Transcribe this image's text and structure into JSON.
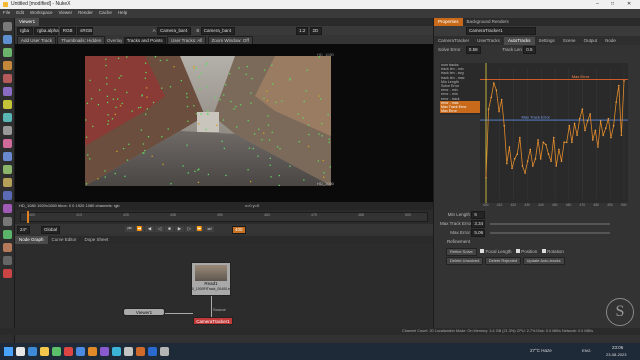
{
  "titlebar": {
    "title": "Untitled [modified] - NukeX",
    "min": "–",
    "max": "□",
    "close": "✕"
  },
  "menubar": {
    "items": [
      "File",
      "Edit",
      "Workspace",
      "Viewer",
      "Render",
      "Cache",
      "Help"
    ]
  },
  "viewer_tab": {
    "label": "Viewer1"
  },
  "viewer_toolbar": {
    "channels": "rgba",
    "alpha": "rgba.alpha",
    "colorspace": "RGB",
    "proxy": "sRGB",
    "ab_a": "A",
    "cam_a": "Camera_bar4",
    "ab_b": "B",
    "cam_b": "Camera_bar4",
    "zoom": "1:2",
    "frame_ctrl": "2D",
    "add_user_track": "Add User Track",
    "thumbnails": "Thumbnails: Hidden",
    "overlay_label": "Overlay",
    "overlay_value": "Tracks and Points",
    "user_tracks": "User Tracks: All",
    "zoom_window": "Zoom Window: Off"
  },
  "viewer": {
    "format_label": "HD_1080",
    "corner_label": "HD_1080",
    "status": "HD_1080 1920x1080  bbox: 0 0 1920 1080 channels: rgb",
    "coords": "x=0 y=0"
  },
  "timeline": {
    "fps": "24*",
    "scope": "Global",
    "frame": "400",
    "ticks": [
      "400",
      "413",
      "425",
      "438",
      "450",
      "463",
      "475",
      "488",
      "500"
    ],
    "current": "400"
  },
  "bottom_tabs": {
    "items": [
      "Node Graph",
      "Curve Editor",
      "Dope Sheet"
    ]
  },
  "nodes": {
    "read": "Read1",
    "read_file": "0_1000FtTrack_00400.exr",
    "camtracker": "CameraTracker1",
    "viewer": "Viewer1",
    "source_label": "Source"
  },
  "panel_tabs": {
    "items": [
      "Properties",
      "Background Renders"
    ]
  },
  "properties": {
    "node_name": "CameraTracker1",
    "tabs": [
      "CameraTracker",
      "UserTracks",
      "AutoTracks",
      "Settings",
      "Scene",
      "Output",
      "Node"
    ],
    "solve_error_label": "Solve Error",
    "solve_error": "0.58",
    "track_len_label": "Track Len",
    "track_len_value": "0.5",
    "curve_list": [
      "num tracks",
      "track len - min",
      "track len - avg",
      "track len - max",
      "Min Length",
      "Solve Error",
      "error - min",
      "error - rms",
      "error - track",
      "error - max",
      "Max Track Error",
      "Max Error"
    ],
    "max_error_label": "Max Error",
    "max_track_error_label": "Max Track Error",
    "min_length_label": "Min Length",
    "min_length": "6",
    "max_track_error_row_label": "Max Track Error",
    "max_track_error": "3.34",
    "max_error_row_label": "Max Error",
    "max_error": "5.06",
    "refinement_label": "Refinement",
    "refine_solve": "Refine Solve",
    "focal_length": "Focal Length",
    "position": "Position",
    "rotation": "Rotation",
    "delete_unsolved": "Delete Unsolved",
    "delete_rejected": "Delete Rejected",
    "update_auto": "Update Auto-tracks"
  },
  "graph_x_ticks": [
    "400",
    "410",
    "420",
    "430",
    "440",
    "450",
    "460",
    "470",
    "480",
    "490",
    "500"
  ],
  "chart_data": {
    "type": "line",
    "series": [
      {
        "name": "error - track",
        "values": [
          0.9,
          3.8,
          4.3,
          4.9,
          4.6,
          3.7,
          4.2,
          3.1,
          1.5,
          2.2,
          1.3,
          1.7,
          1.9,
          2.6,
          1.4,
          1.1,
          1.6,
          2.1,
          1.4,
          1.7,
          2.5,
          1.7,
          2.4,
          2.3,
          1.9,
          1.6,
          2.6,
          1.4,
          2.1,
          1.6,
          2.4,
          2.4,
          3.1,
          2.4,
          3.2,
          2.7,
          3.4,
          3.8,
          2.9,
          3.3,
          3.6,
          2.5,
          2.9,
          2.2,
          3.3,
          2.7,
          3.0,
          3.4,
          2.6,
          3.1,
          4.1,
          4.8,
          2.7,
          5.0
        ]
      }
    ],
    "max_track_error": 3.34,
    "max_error": 5.06,
    "ylim": [
      0,
      5.5
    ]
  },
  "statusbar": {
    "text": "Channel Count: 20  Localization Mode: On  Memory: 3.4 GB (21.3%)  CPU: 2.7%  Disk: 0.0 MB/s  Network: 0.0 MB/s"
  },
  "taskbar": {
    "weather": "27°C Haze",
    "time": "23:06",
    "date": "23-08-2023",
    "lang": "ENG",
    "search": "Search"
  }
}
